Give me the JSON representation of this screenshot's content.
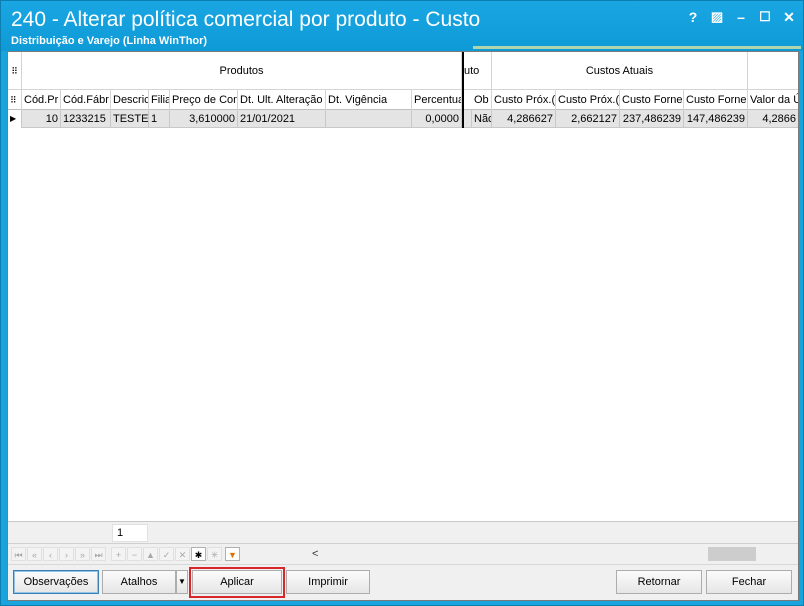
{
  "window": {
    "title": "240 - Alterar política comercial por produto - Custo",
    "subtitle": "Distribuição e Varejo (Linha WinThor)",
    "controls": {
      "help": "?",
      "restore": "▨",
      "minimize": "–",
      "maximize": "☐",
      "close": "✕"
    }
  },
  "grid": {
    "band_headers": [
      "Produtos",
      "uto",
      "Custos Atuais"
    ],
    "columns": [
      "Cód.Pr",
      "Cód.Fábr",
      "Descric",
      "Filia",
      "Preço de Com",
      "Dt. Ult. Alteração",
      "Dt. Vigência",
      "Percentual",
      "Ob",
      "Custo Próx.(",
      "Custo Próx.(",
      "Custo Forne",
      "Custo Forne",
      "Valor da Ú"
    ],
    "rows": [
      [
        "10",
        "1233215",
        "TESTES",
        "1",
        "3,610000",
        "21/01/2021",
        "",
        "0,0000",
        "Não",
        "4,286627",
        "2,662127",
        "237,486239",
        "147,486239",
        "4,2866"
      ]
    ],
    "record_indicator": "▶",
    "corner_icon": "grid-menu-icon"
  },
  "footer": {
    "count": "1"
  },
  "navigator": {
    "buttons": [
      "first-page",
      "prev-page",
      "prev",
      "next",
      "next-page",
      "last-page",
      "insert",
      "delete",
      "edit",
      "post",
      "cancel",
      "refresh",
      "filter",
      "bookmark",
      "filter-funnel"
    ],
    "scroll_left": "<"
  },
  "buttons": {
    "observacoes": "Observações",
    "atalhos": "Atalhos",
    "aplicar": "Aplicar",
    "imprimir": "Imprimir",
    "retornar": "Retornar",
    "fechar": "Fechar"
  },
  "colors": {
    "title_bg": "#0aa3df",
    "highlight": "#d9262b"
  }
}
